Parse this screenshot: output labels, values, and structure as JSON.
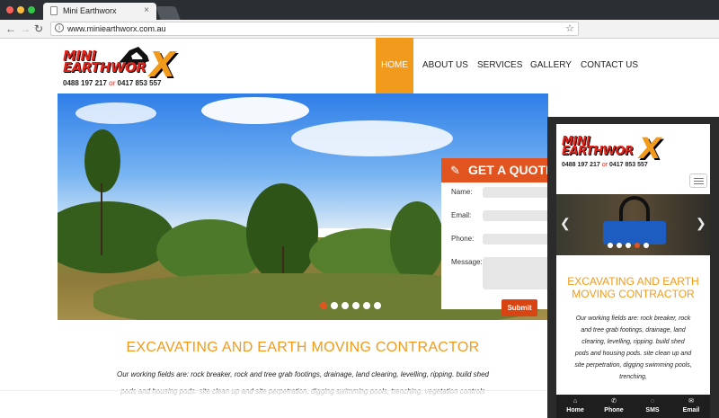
{
  "browser": {
    "tab_title": "Mini Earthworx",
    "close_glyph": "×",
    "back_glyph": "←",
    "forward_glyph": "→",
    "reload_glyph": "↻",
    "url": "www.miniearthworx.com.au",
    "info_glyph": "i",
    "star_glyph": "☆"
  },
  "logo": {
    "line1": "MINI",
    "line2": "EARTHWOR",
    "x": "X",
    "phone1": "0488 197 217",
    "or": "or",
    "phone2": "0417 853 557"
  },
  "nav": {
    "items": [
      "HOME",
      "ABOUT US",
      "SERVICES",
      "GALLERY",
      "CONTACT US"
    ],
    "active": "HOME"
  },
  "quote_form": {
    "title": "GET A QUOTE",
    "name_label": "Name:",
    "email_label": "Email:",
    "phone_label": "Phone:",
    "message_label": "Message:",
    "submit_label": "Submit"
  },
  "slider": {
    "count": 6,
    "active_index": 0
  },
  "content": {
    "heading": "EXCAVATING AND EARTH MOVING CONTRACTOR",
    "body_line1": "Our working fields are: rock breaker, rock and tree grab footings, drainage, land clearing, levelling, ripping. build shed",
    "body_line2": "pods and housing pods. site clean up and site perpetration, digging swimming pools, trenching, vegetation controls"
  },
  "mobile": {
    "heading": "EXCAVATING AND EARTH MOVING CONTRACTOR",
    "body": "Our working fields are: rock breaker, rock and tree grab footings, drainage, land clearing, levelling, ripping. build shed pods and housing pods. site clean up and site perpetration, digging swimming pools, trenching,",
    "prev_glyph": "❮",
    "next_glyph": "❯",
    "slider": {
      "count": 5,
      "active_index": 3
    },
    "footer": [
      {
        "label": "Home",
        "icon": "home-icon",
        "glyph": "⌂"
      },
      {
        "label": "Phone",
        "icon": "phone-icon",
        "glyph": "✆"
      },
      {
        "label": "SMS",
        "icon": "chat-icon",
        "glyph": "◌"
      },
      {
        "label": "Email",
        "icon": "email-icon",
        "glyph": "✉"
      }
    ]
  },
  "colors": {
    "accent": "#f29a1b",
    "form_header": "#e2541f",
    "submit": "#d94512",
    "logo_red": "#e2231a"
  }
}
